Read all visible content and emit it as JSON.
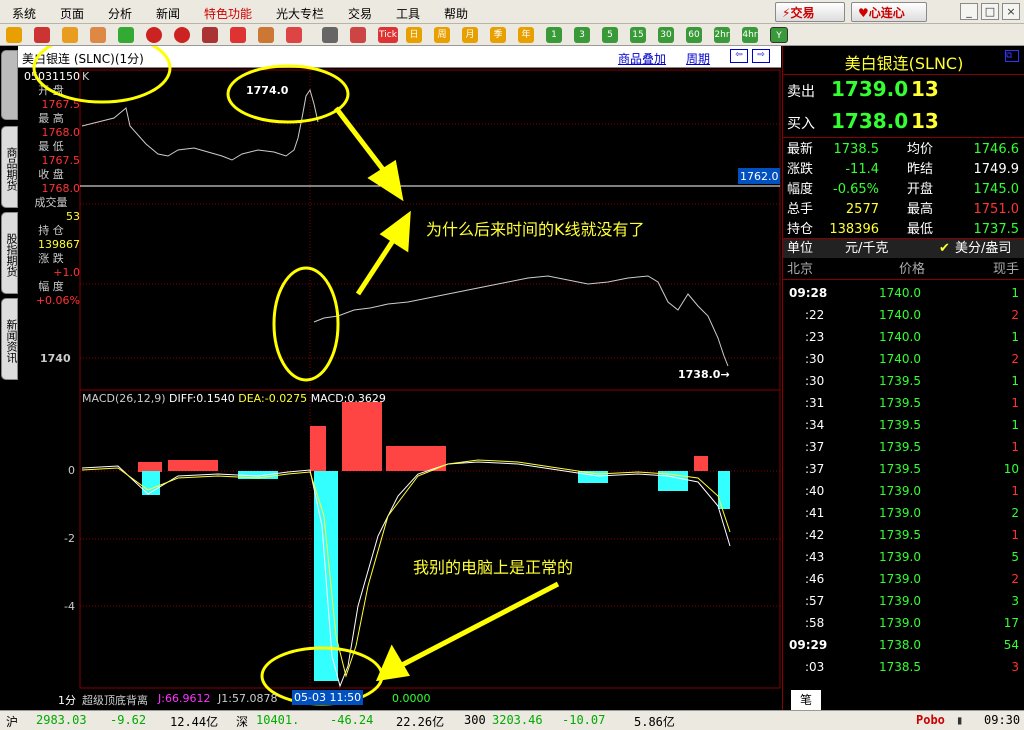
{
  "menu": {
    "items": [
      "系统",
      "页面",
      "分析",
      "新闻",
      "特色功能",
      "光大专栏",
      "交易",
      "工具",
      "帮助"
    ],
    "trade_button": "交易",
    "xinlian_button": "心连心",
    "min_icon": "_",
    "restore_icon": "□",
    "close_icon": "×"
  },
  "toolbar": {
    "buttons": [
      "back",
      "home",
      "book",
      "chart",
      "refresh",
      "zoom-in",
      "zoom-out",
      "window",
      "pen",
      "draw",
      "funnel",
      "table",
      "bars",
      "tick",
      "day",
      "week",
      "month",
      "season",
      "year",
      "1",
      "3",
      "5",
      "15",
      "30",
      "60",
      "2hr",
      "4hr",
      "Y"
    ],
    "labels": {
      "tick": "Tick",
      "day": "日",
      "week": "周",
      "month": "月",
      "season": "季",
      "year": "年",
      "n1": "1",
      "n3": "3",
      "n5": "5",
      "n15": "15",
      "n30": "30",
      "n60": "60",
      "h2": "2hr",
      "h4": "4hr",
      "y": "Y"
    }
  },
  "left_tabs": [
    "商品期货",
    "股指期货",
    "新闻资讯"
  ],
  "chart_header": {
    "title": "美白银连 (SLNC)(1分)",
    "overlay_link": "商品叠加",
    "cycle_link": "周期",
    "k_label": "K"
  },
  "info": {
    "code": "05031150",
    "open_label": "开 盘",
    "open": "1767.5",
    "high_label": "最 高",
    "high": "1768.0",
    "low_label": "最 低",
    "low": "1767.5",
    "close_label": "收 盘",
    "close": "1768.0",
    "vol_label": "成交量",
    "vol": "53",
    "oi_label": "持 仓",
    "oi": "139867",
    "chg_label": "涨 跌",
    "chg": "+1.0",
    "pct_label": "幅 度",
    "pct": "+0.06%"
  },
  "price_axis": {
    "label_1740": "1740",
    "hi_label": "1774.0",
    "last_label": "1738.0→",
    "cursor_price": "1762.0"
  },
  "macd": {
    "title": "MACD(26,12,9)",
    "diff": "DIFF:0.1540",
    "dea": "DEA:-0.0275",
    "macd": "MACD:0.3629",
    "ticks": [
      "0",
      "-2",
      "-4"
    ]
  },
  "bottom_bar": {
    "period": "1分",
    "ind1": "超级顶底背离",
    "j": "J:66.9612",
    "j1": "J1:57.0878",
    "time": "05-03 11:50",
    "zero": "0.0000"
  },
  "annotations": {
    "q1": "为什么后来时间的K线就没有了",
    "q2": "我别的电脑上是正常的"
  },
  "quote": {
    "name": "美白银连(SLNC)",
    "sell_label": "卖出",
    "sell_price": "1739.0",
    "sell_qty": "13",
    "buy_label": "买入",
    "buy_price": "1738.0",
    "buy_qty": "13",
    "rows": [
      [
        "最新",
        "1738.5",
        "均价",
        "1746.6"
      ],
      [
        "涨跌",
        "-11.4",
        "昨结",
        "1749.9"
      ],
      [
        "幅度",
        "-0.65%",
        "开盘",
        "1745.0"
      ],
      [
        "总手",
        "2577",
        "最高",
        "1751.0"
      ],
      [
        "持仓",
        "138396",
        "最低",
        "1737.5"
      ]
    ],
    "unit_label": "单位",
    "unit_value": "元/千克",
    "unit_alt": "美分/盎司",
    "tick_head": [
      "北京",
      "价格",
      "现手"
    ],
    "ticks": [
      [
        "09:28",
        "1740.0",
        "1"
      ],
      [
        ":22",
        "1740.0",
        "2"
      ],
      [
        ":23",
        "1740.0",
        "1"
      ],
      [
        ":30",
        "1740.0",
        "2"
      ],
      [
        ":30",
        "1739.5",
        "1"
      ],
      [
        ":31",
        "1739.5",
        "1"
      ],
      [
        ":34",
        "1739.5",
        "1"
      ],
      [
        ":37",
        "1739.5",
        "1"
      ],
      [
        ":37",
        "1739.5",
        "10"
      ],
      [
        ":40",
        "1739.0",
        "1"
      ],
      [
        ":41",
        "1739.0",
        "2"
      ],
      [
        ":42",
        "1739.5",
        "1"
      ],
      [
        ":43",
        "1739.0",
        "5"
      ],
      [
        ":46",
        "1739.0",
        "2"
      ],
      [
        ":57",
        "1739.0",
        "3"
      ],
      [
        ":58",
        "1739.0",
        "17"
      ],
      [
        "09:29",
        "1738.0",
        "54"
      ],
      [
        ":03",
        "1738.5",
        "3"
      ]
    ],
    "bottom_tab": "笔"
  },
  "status": {
    "sh_label": "沪",
    "sh_idx": "2983.03",
    "sh_chg": "-9.62",
    "sh_amt": "12.44亿",
    "sz_label": "深",
    "sz_idx": "10401.",
    "sz_chg": "-46.24",
    "sz_amt": "22.26亿",
    "h300_label": "300",
    "h300_idx": "3203.46",
    "h300_chg": "-10.07",
    "h300_amt": "5.86亿",
    "brand": "Pobo",
    "time": "09:30"
  }
}
